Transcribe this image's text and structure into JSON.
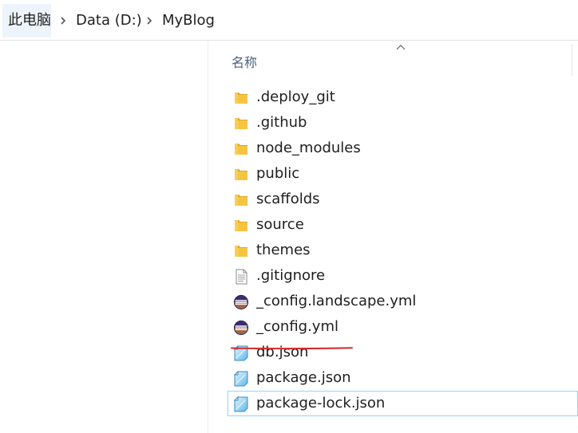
{
  "breadcrumb": {
    "items": [
      {
        "label": "此电脑"
      },
      {
        "label": "Data (D:)"
      },
      {
        "label": "MyBlog"
      }
    ]
  },
  "columns": {
    "name_header": "名称",
    "sort": "ascending"
  },
  "files": [
    {
      "name": ".deploy_git",
      "type": "folder"
    },
    {
      "name": ".github",
      "type": "folder"
    },
    {
      "name": "node_modules",
      "type": "folder"
    },
    {
      "name": "public",
      "type": "folder"
    },
    {
      "name": "scaffolds",
      "type": "folder"
    },
    {
      "name": "source",
      "type": "folder"
    },
    {
      "name": "themes",
      "type": "folder"
    },
    {
      "name": ".gitignore",
      "type": "text-file"
    },
    {
      "name": "_config.landscape.yml",
      "type": "eclipse-file"
    },
    {
      "name": "_config.yml",
      "type": "eclipse-file",
      "annotated": true
    },
    {
      "name": "db.json",
      "type": "json-file"
    },
    {
      "name": "package.json",
      "type": "json-file"
    },
    {
      "name": "package-lock.json",
      "type": "json-file",
      "selected": true
    }
  ],
  "colors": {
    "folder": "#f5c542",
    "folder_dark": "#e0a823",
    "selection_border": "#99d1ff",
    "annotation_underline": "#d9262b",
    "header_text": "#4c607a"
  },
  "icons": {
    "separator": "chevron-right-icon",
    "sort": "sort-up-icon",
    "folder": "folder-icon",
    "text-file": "text-file-icon",
    "eclipse-file": "eclipse-file-icon",
    "json-file": "json-file-icon"
  }
}
